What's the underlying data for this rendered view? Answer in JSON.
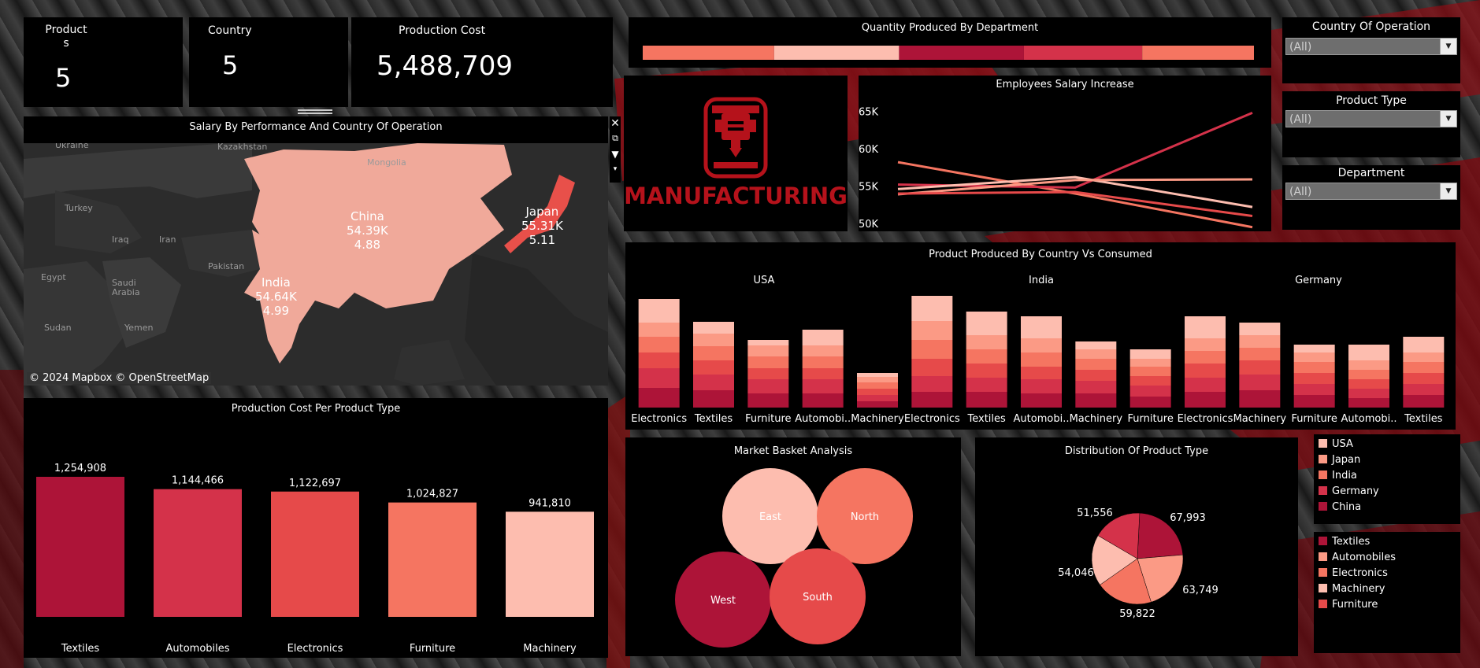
{
  "colors": {
    "c1": "#ad1438",
    "c2": "#d4324a",
    "c3": "#e64a4a",
    "c4": "#f57561",
    "c5": "#fb9a85",
    "c6": "#fdbdaf"
  },
  "kpis": [
    {
      "label": "Product\ns",
      "value": "5"
    },
    {
      "label": "Country",
      "value": "5"
    },
    {
      "label": "Production Cost",
      "value": "5,488,709"
    }
  ],
  "quantity_by_department": {
    "title": "Quantity Produced By Department"
  },
  "map": {
    "title": "Salary By Performance And Country Of Operation",
    "attribution": "© 2024 Mapbox © OpenStreetMap",
    "places": [
      "Ukraine",
      "Kazakhstan",
      "Mongolia",
      "Turkey",
      "Iraq",
      "Iran",
      "Pakistan",
      "Egypt",
      "Saudi\nArabia",
      "Yemen",
      "Sudan"
    ],
    "countries": [
      {
        "name": "China",
        "salary": "54.39K",
        "score": "4.88"
      },
      {
        "name": "Japan",
        "salary": "55.31K",
        "score": "5.11"
      },
      {
        "name": "India",
        "salary": "54.64K",
        "score": "4.99"
      }
    ]
  },
  "logo": {
    "text": "MANUFACTURING"
  },
  "salary_increase": {
    "title": "Employees Salary Increase"
  },
  "produced_vs_consumed": {
    "title": "Product Produced By Country Vs Consumed"
  },
  "production_cost_per_type": {
    "title": "Production Cost Per Product Type"
  },
  "market_basket": {
    "title": "Market Basket Analysis"
  },
  "distribution": {
    "title": "Distribution Of Product Type"
  },
  "filters": [
    {
      "label": "Country Of Operation",
      "value": "(All)"
    },
    {
      "label": "Product Type",
      "value": "(All)"
    },
    {
      "label": "Department",
      "value": "(All)"
    }
  ],
  "legend_country": [
    {
      "label": "USA",
      "color": "#fdbdaf"
    },
    {
      "label": "Japan",
      "color": "#fb9a85"
    },
    {
      "label": "India",
      "color": "#f57561"
    },
    {
      "label": "Germany",
      "color": "#d4324a"
    },
    {
      "label": "China",
      "color": "#ad1438"
    }
  ],
  "legend_product": [
    {
      "label": "Textiles",
      "color": "#ad1438"
    },
    {
      "label": "Automobiles",
      "color": "#fb9a85"
    },
    {
      "label": "Electronics",
      "color": "#f57561"
    },
    {
      "label": "Machinery",
      "color": "#fdbdaf"
    },
    {
      "label": "Furniture",
      "color": "#e64a4a"
    }
  ],
  "chart_data": [
    {
      "type": "bar",
      "title": "Quantity Produced By Department",
      "orientation": "horizontal-stacked",
      "series": [
        {
          "values": [
            20
          ]
        },
        {
          "values": [
            19
          ]
        },
        {
          "values": [
            19
          ]
        },
        {
          "values": [
            18
          ]
        },
        {
          "values": [
            17
          ]
        }
      ],
      "colors": [
        "#f57561",
        "#fdbdaf",
        "#ad1438",
        "#d4324a",
        "#f57561"
      ]
    },
    {
      "type": "line",
      "title": "Employees Salary Increase",
      "yticks": [
        "65K",
        "60K",
        "55K",
        "50K"
      ],
      "ylim": [
        50000,
        66000
      ],
      "series": [
        {
          "values": [
            58200,
            54000,
            49500
          ],
          "color": "#f57561"
        },
        {
          "values": [
            55200,
            54800,
            64800
          ],
          "color": "#d4324a"
        },
        {
          "values": [
            54600,
            56200,
            52200
          ],
          "color": "#fdbdaf"
        },
        {
          "values": [
            53900,
            55800,
            55900
          ],
          "color": "#fb9a85"
        },
        {
          "values": [
            54000,
            54200,
            51000
          ],
          "color": "#e64a4a"
        }
      ]
    },
    {
      "type": "bar",
      "title": "Product Produced By Country Vs Consumed",
      "groups": [
        "USA",
        "India",
        "Germany"
      ],
      "categories": [
        "Electronics",
        "Textiles",
        "Furniture",
        "Automobi..",
        "Machinery",
        "Electronics",
        "Textiles",
        "Automobi..",
        "Machinery",
        "Furniture",
        "Electronics",
        "Machinery",
        "Furniture",
        "Automobi..",
        "Textiles"
      ],
      "stack_colors": [
        "#ad1438",
        "#d4324a",
        "#e64a4a",
        "#f57561",
        "#fb9a85",
        "#fdbdaf"
      ],
      "stacks": [
        [
          25,
          25,
          20,
          20,
          18,
          30
        ],
        [
          22,
          20,
          18,
          18,
          16,
          15
        ],
        [
          18,
          18,
          14,
          15,
          14,
          7
        ],
        [
          18,
          18,
          14,
          15,
          14,
          20
        ],
        [
          8,
          8,
          8,
          8,
          7,
          5
        ],
        [
          20,
          20,
          22,
          24,
          24,
          32
        ],
        [
          20,
          18,
          18,
          18,
          18,
          30
        ],
        [
          18,
          18,
          16,
          18,
          18,
          28
        ],
        [
          18,
          16,
          14,
          14,
          12,
          10
        ],
        [
          14,
          14,
          12,
          12,
          10,
          12
        ],
        [
          20,
          18,
          18,
          16,
          16,
          28
        ],
        [
          22,
          20,
          18,
          16,
          16,
          16
        ],
        [
          16,
          14,
          14,
          14,
          12,
          10
        ],
        [
          12,
          12,
          12,
          12,
          12,
          20
        ],
        [
          16,
          14,
          14,
          14,
          12,
          20
        ]
      ],
      "ylim": [
        0,
        150
      ]
    },
    {
      "type": "bar",
      "title": "Production Cost Per Product Type",
      "categories": [
        "Textiles",
        "Automobiles",
        "Electronics",
        "Furniture",
        "Machinery"
      ],
      "values": [
        1254908,
        1144466,
        1122697,
        1024827,
        941810
      ],
      "value_labels": [
        "1,254,908",
        "1,144,466",
        "1,122,697",
        "1,024,827",
        "941,810"
      ],
      "colors": [
        "#ad1438",
        "#d4324a",
        "#e64a4a",
        "#f57561",
        "#fdbdaf"
      ],
      "ylim": [
        0,
        1350000
      ]
    },
    {
      "type": "bubble",
      "title": "Market Basket Analysis",
      "items": [
        {
          "label": "East",
          "color": "#fdbdaf"
        },
        {
          "label": "North",
          "color": "#f57561"
        },
        {
          "label": "West",
          "color": "#ad1438"
        },
        {
          "label": "South",
          "color": "#e64a4a"
        }
      ]
    },
    {
      "type": "pie",
      "title": "Distribution Of Product Type",
      "values": [
        67993,
        63749,
        59822,
        54046,
        51556
      ],
      "value_labels": [
        "67,993",
        "63,749",
        "59,822",
        "54,046",
        "51,556"
      ],
      "colors": [
        "#ad1438",
        "#fb9a85",
        "#f57561",
        "#fdbdaf",
        "#d4324a"
      ]
    }
  ]
}
